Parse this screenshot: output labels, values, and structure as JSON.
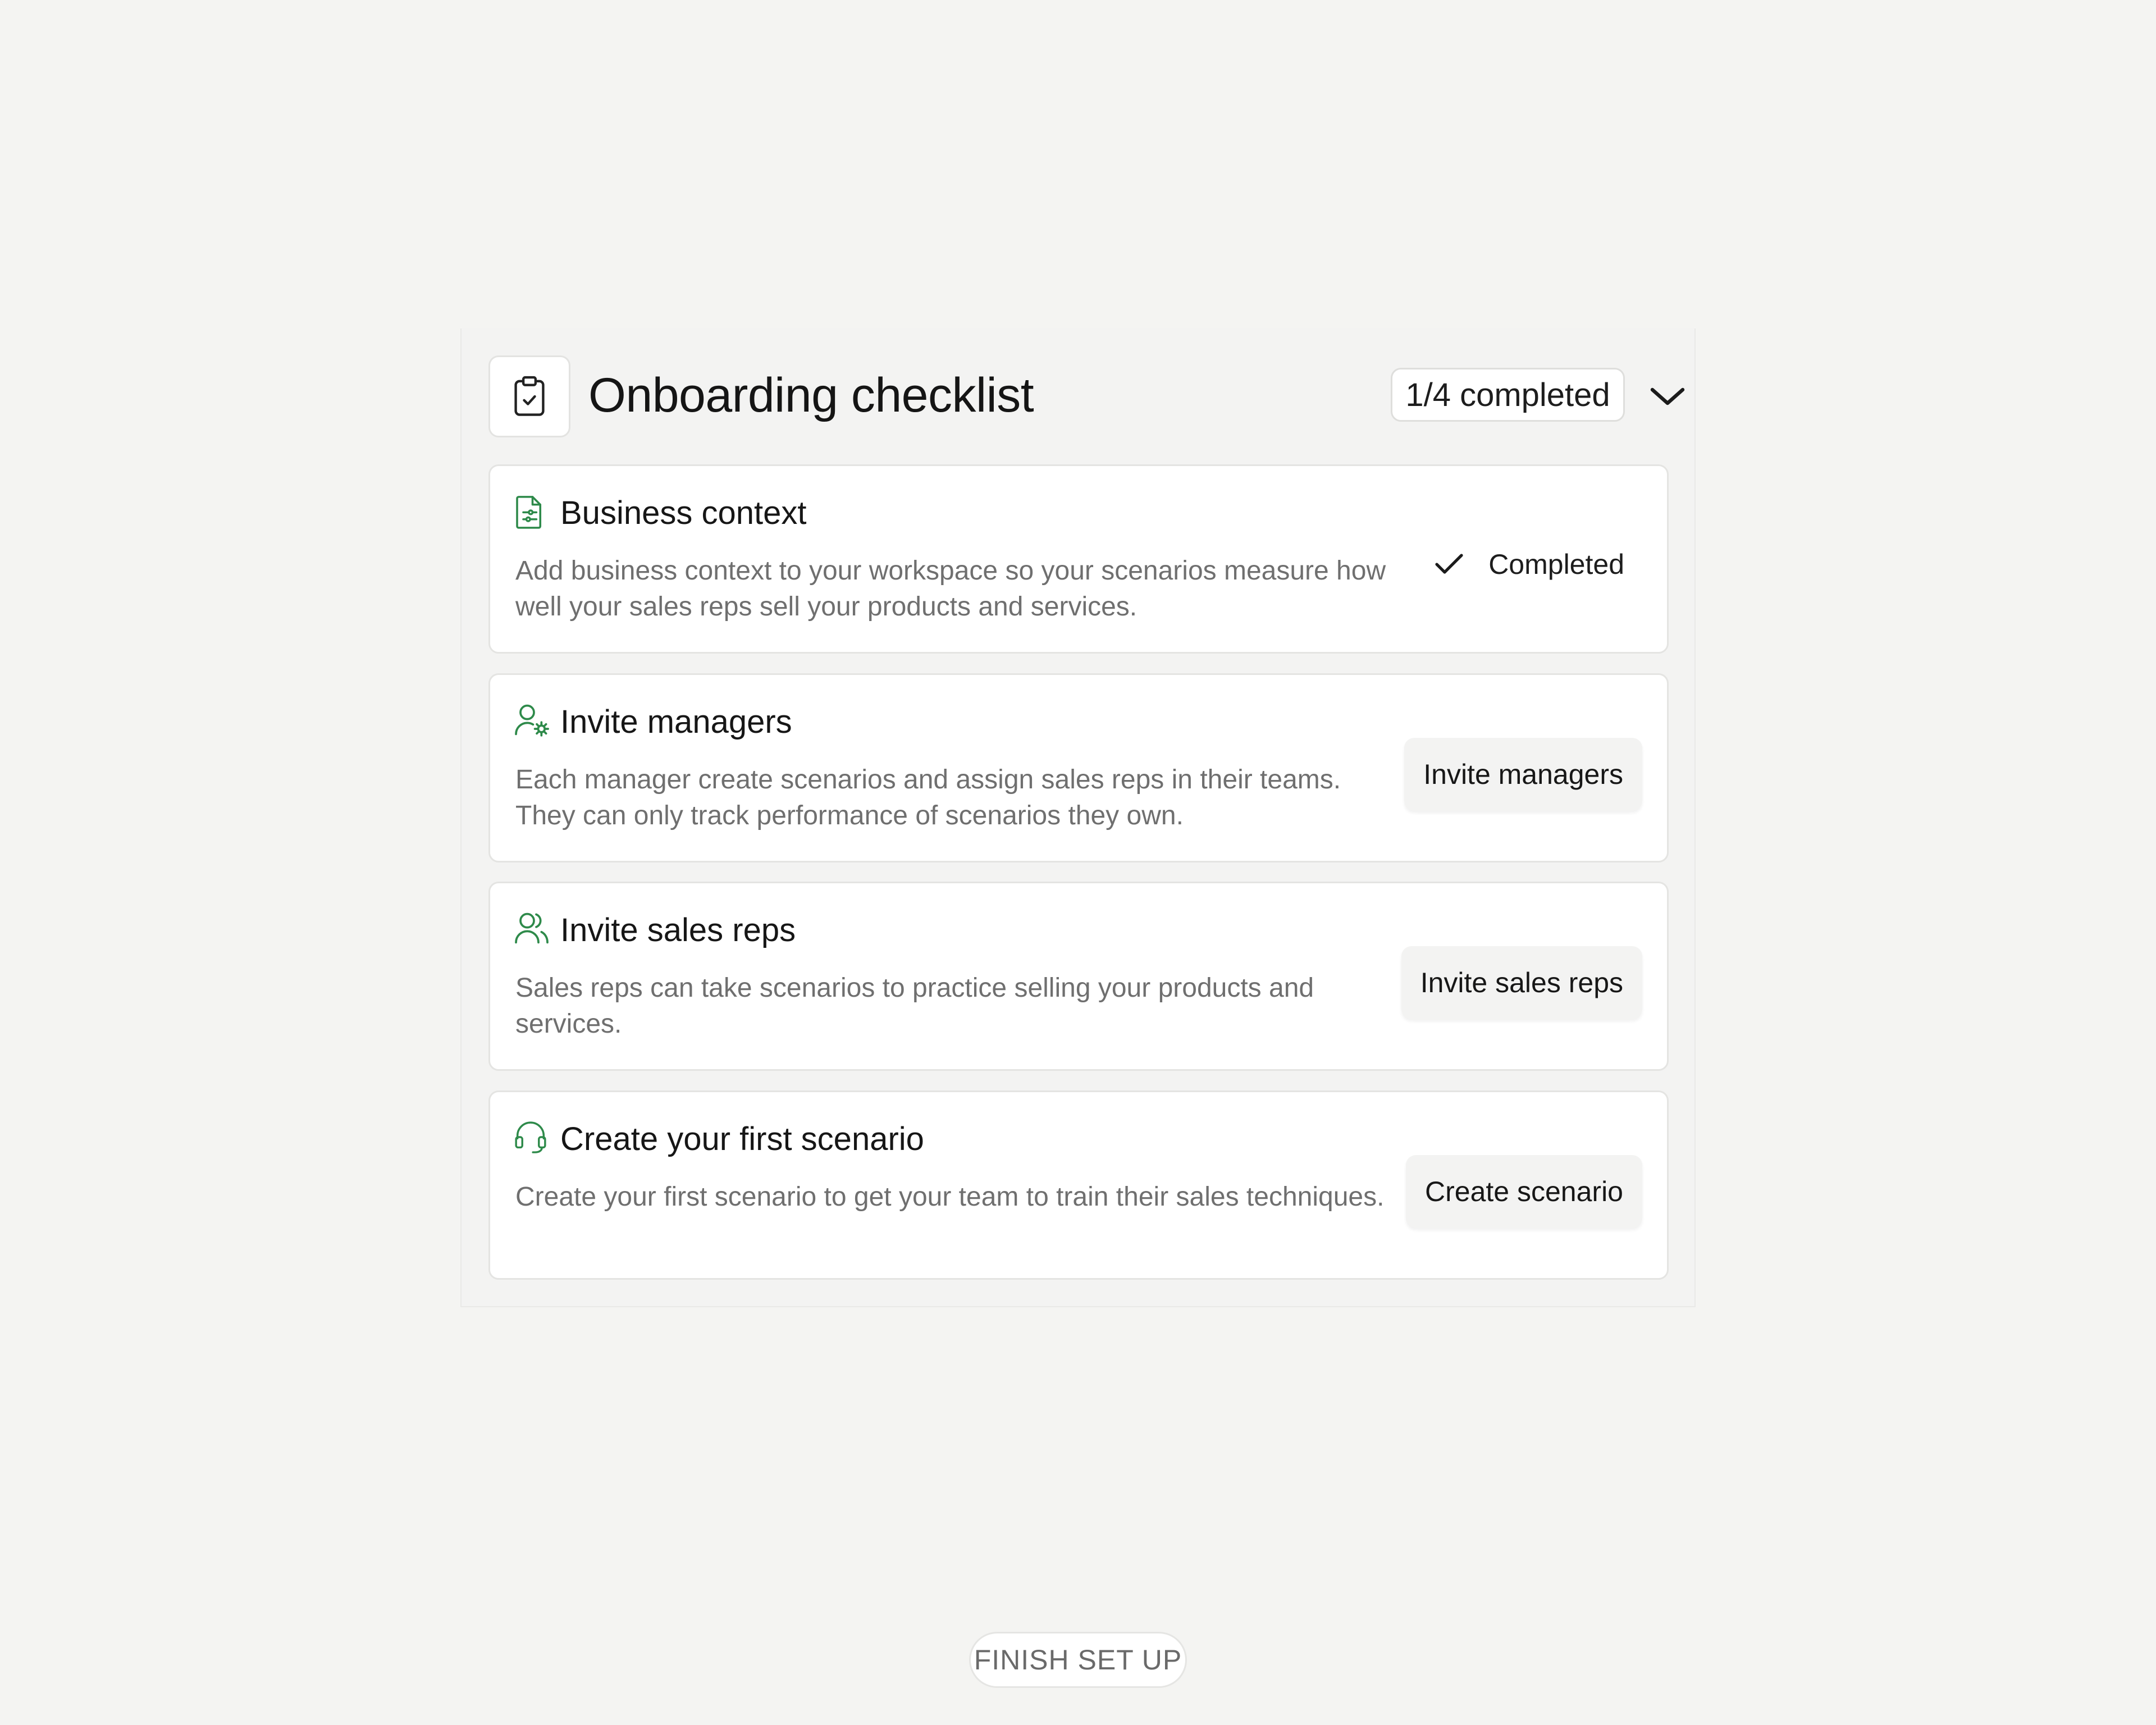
{
  "checklist": {
    "title": "Onboarding checklist",
    "progress": "1/4 completed",
    "icons": {
      "header": "clipboard-check-icon",
      "toggle": "chevron-down-icon"
    },
    "accent_color": "#2e8a4a",
    "items": [
      {
        "title": "Business context",
        "description": "Add business context to your workspace so your scenarios measure how well your sales reps sell your products and services.",
        "icon": "document-settings-icon",
        "status": "Completed",
        "status_icon": "check-icon"
      },
      {
        "title": "Invite managers",
        "description": "Each manager create scenarios and assign sales reps in their teams. They can only track performance of scenarios they own.",
        "icon": "user-gear-icon",
        "action": "Invite managers"
      },
      {
        "title": "Invite sales reps",
        "description": "Sales reps can take scenarios to practice selling your products and services.",
        "icon": "users-icon",
        "action": "Invite sales reps"
      },
      {
        "title": "Create your first scenario",
        "description": "Create your first scenario to get your team to train their sales techniques.",
        "icon": "headset-icon",
        "action": "Create scenario"
      }
    ]
  },
  "footer": {
    "button": "FINISH SET UP"
  }
}
